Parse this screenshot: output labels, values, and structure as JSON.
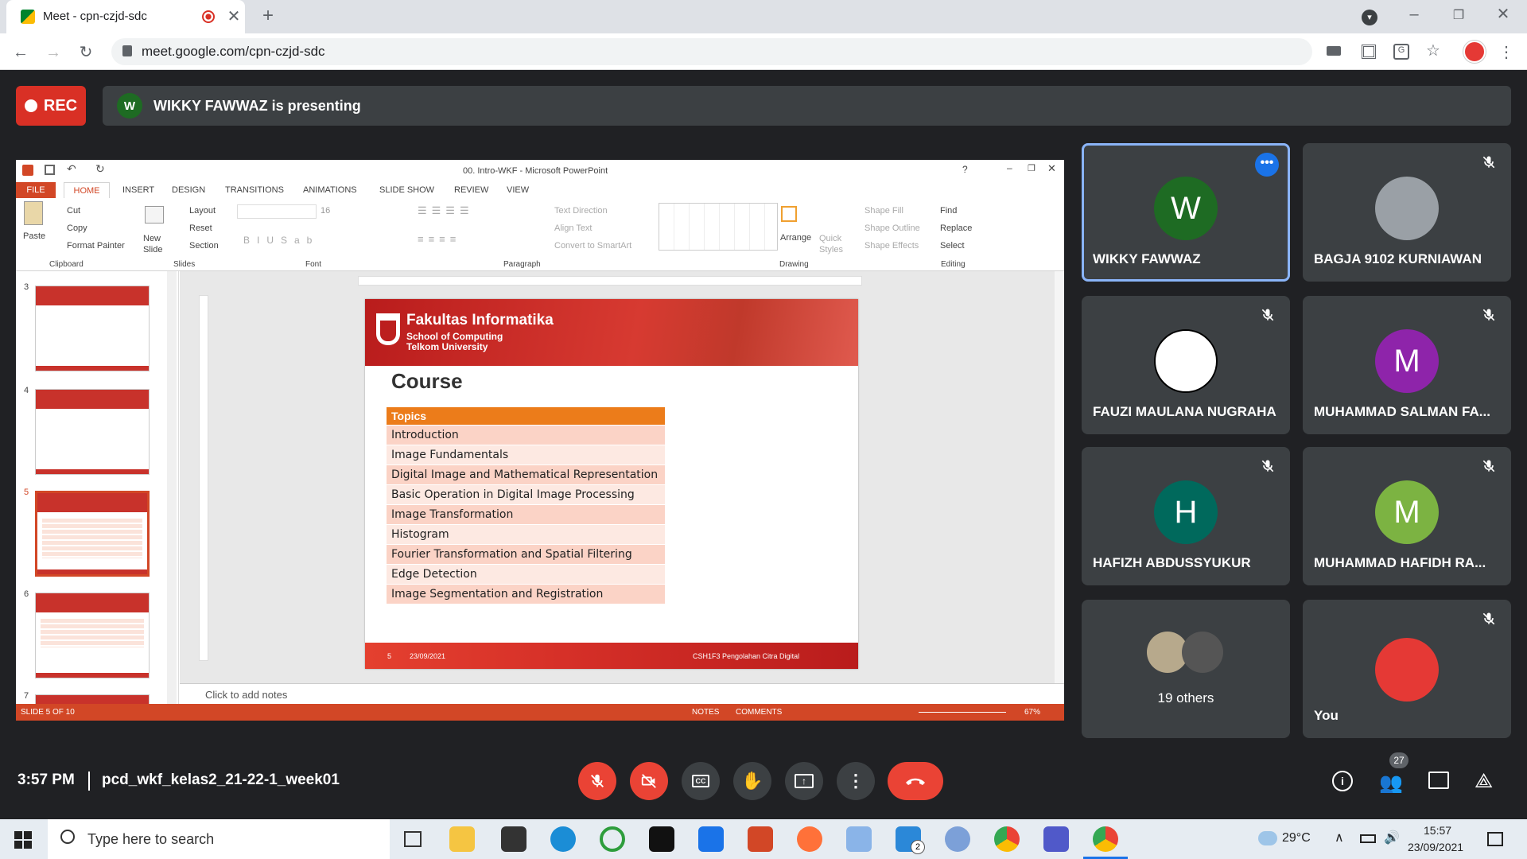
{
  "browser": {
    "tab_title": "Meet - cpn-czjd-sdc",
    "url": "meet.google.com/cpn-czjd-sdc"
  },
  "meet": {
    "rec_label": "REC",
    "presenter_initial": "W",
    "presenting_text": "WIKKY FAWWAZ is presenting",
    "time": "3:57 PM",
    "meeting_code": "pcd_wkf_kelas2_21-22-1_week01",
    "participants_count": "27",
    "participants": [
      {
        "name": "WIKKY FAWWAZ",
        "initial": "W",
        "color": "#1e6b23",
        "active": true
      },
      {
        "name": "BAGJA 9102 KURNIAWAN",
        "initial": "",
        "color": "#9aa0a6"
      },
      {
        "name": "FAUZI MAULANA NUGRAHA",
        "initial": "",
        "color": "#ffffff"
      },
      {
        "name": "MUHAMMAD SALMAN FA...",
        "initial": "M",
        "color": "#8e24aa"
      },
      {
        "name": "HAFIZH ABDUSSYUKUR",
        "initial": "H",
        "color": "#00695c"
      },
      {
        "name": "MUHAMMAD HAFIDH RA...",
        "initial": "M",
        "color": "#7cb342"
      },
      {
        "name": "19 others",
        "initial": "",
        "color": "#9aa0a6"
      },
      {
        "name": "You",
        "initial": "",
        "color": "#e53935"
      }
    ]
  },
  "ppt": {
    "title": "00. Intro-WKF - Microsoft PowerPoint",
    "tabs": [
      "FILE",
      "HOME",
      "INSERT",
      "DESIGN",
      "TRANSITIONS",
      "ANIMATIONS",
      "SLIDE SHOW",
      "REVIEW",
      "VIEW"
    ],
    "clipboard": {
      "paste": "Paste",
      "cut": "Cut",
      "copy": "Copy",
      "format_painter": "Format Painter",
      "group": "Clipboard"
    },
    "slides_group": {
      "new_slide": "New Slide",
      "layout": "Layout",
      "reset": "Reset",
      "section": "Section",
      "group": "Slides"
    },
    "font_group": {
      "size": "16",
      "group": "Font"
    },
    "paragraph_group": {
      "text_direction": "Text Direction",
      "align_text": "Align Text",
      "convert": "Convert to SmartArt",
      "group": "Paragraph"
    },
    "drawing_group": {
      "arrange": "Arrange",
      "quick_styles": "Quick Styles",
      "shape_fill": "Shape Fill",
      "shape_outline": "Shape Outline",
      "shape_effects": "Shape Effects",
      "group": "Drawing"
    },
    "editing_group": {
      "find": "Find",
      "replace": "Replace",
      "select": "Select",
      "group": "Editing"
    },
    "thumb_numbers": [
      "3",
      "4",
      "5",
      "6",
      "7"
    ],
    "slide": {
      "brand": "Fakultas Informatika",
      "brand_sub1": "School of Computing",
      "brand_sub2": "Telkom University",
      "heading": "Course",
      "table_header": "Topics",
      "topics": [
        "Introduction",
        "Image Fundamentals",
        "Digital Image and Mathematical Representation",
        "Basic Operation in Digital Image Processing",
        "Image Transformation",
        "Histogram",
        "Fourier Transformation and Spatial Filtering",
        "Edge Detection",
        "Image Segmentation and Registration"
      ],
      "footer_num": "5",
      "footer_date": "23/09/2021",
      "footer_right": "CSH1F3 Pengolahan Citra Digital"
    },
    "notes_placeholder": "Click to add notes",
    "status": {
      "slide": "SLIDE 5 OF 10",
      "notes": "NOTES",
      "comments": "COMMENTS",
      "zoom": "67%"
    }
  },
  "taskbar": {
    "search_placeholder": "Type here to search",
    "temperature": "29°C",
    "clock_time": "15:57",
    "clock_date": "23/09/2021",
    "mail_badge": "2"
  }
}
